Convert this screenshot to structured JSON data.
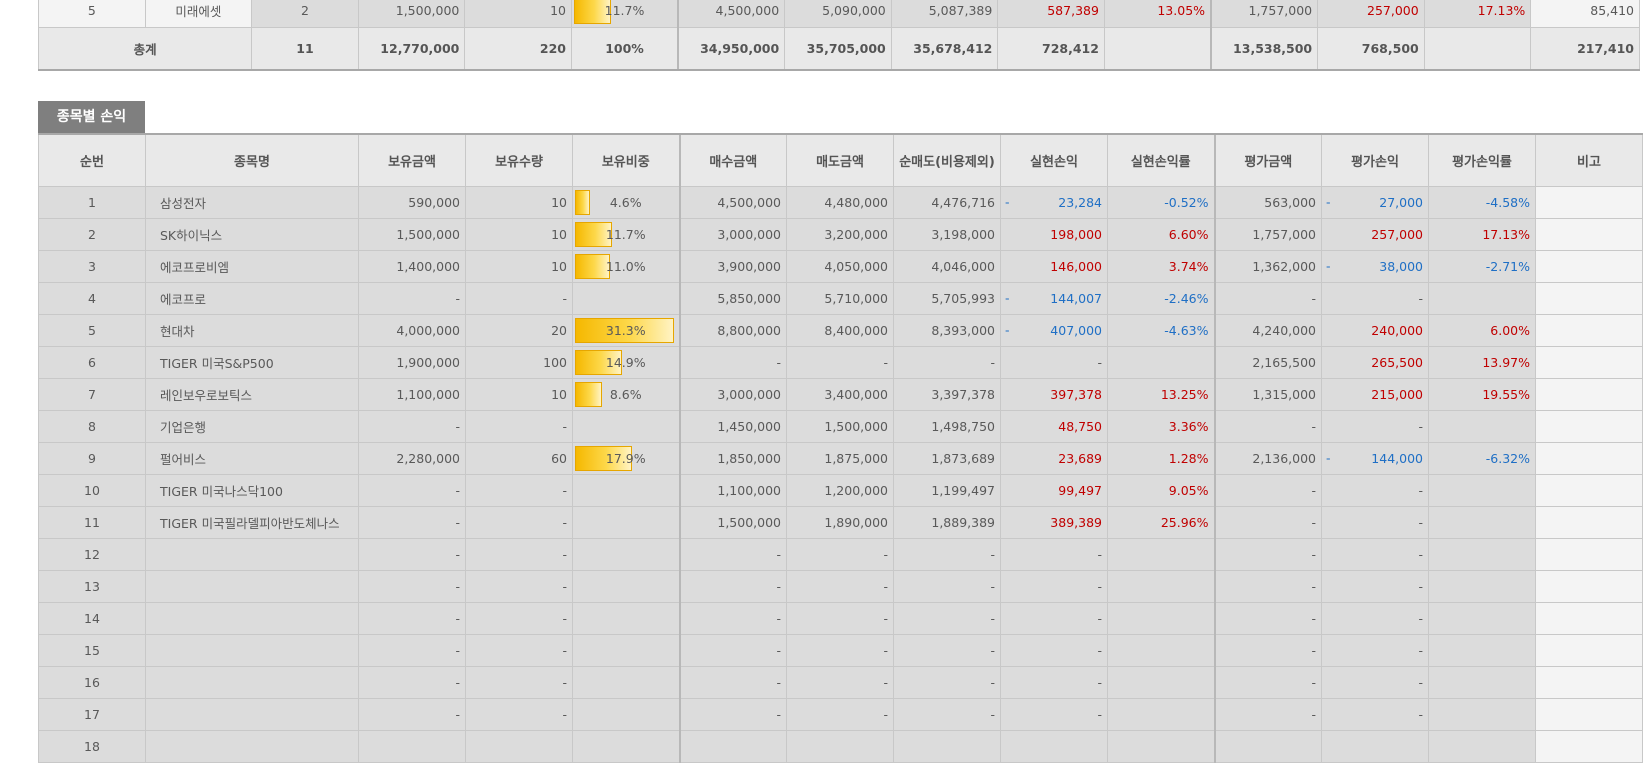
{
  "summary": {
    "top_row": {
      "no": "5",
      "name": "미래에셋",
      "count": "2",
      "holding": "1,500,000",
      "qty": "10",
      "weight": "11.7%",
      "weight_value": 11.7,
      "buy": "4,500,000",
      "sell": "5,090,000",
      "net_sell": "5,087,389",
      "realized": "587,389",
      "realized_rate": "13.05%",
      "eval": "1,757,000",
      "eval_pnl": "257,000",
      "eval_rate": "17.13%",
      "note": "85,410"
    },
    "total_row": {
      "label": "총계",
      "count": "11",
      "holding": "12,770,000",
      "qty": "220",
      "weight": "100%",
      "buy": "34,950,000",
      "sell": "35,705,000",
      "net_sell": "35,678,412",
      "realized": "728,412",
      "realized_rate": "",
      "eval": "13,538,500",
      "eval_pnl": "768,500",
      "eval_rate": "",
      "note": "217,410"
    }
  },
  "section_title": "종목별 손익",
  "headers": [
    "순번",
    "종목명",
    "보유금액",
    "보유수량",
    "보유비중",
    "매수금액",
    "매도금액",
    "순매도(비용제외)",
    "실현손익",
    "실현손익률",
    "평가금액",
    "평가손익",
    "평가손익률",
    "비고"
  ],
  "rows": [
    {
      "no": "1",
      "name": "삼성전자",
      "holding": "590,000",
      "qty": "10",
      "weight": "4.6%",
      "w": 4.6,
      "buy": "4,500,000",
      "sell": "4,480,000",
      "net": "4,476,716",
      "rp_neg": true,
      "rp": "23,284",
      "rr": "-0.52%",
      "rr_neg": true,
      "ev": "563,000",
      "ep_neg": true,
      "ep": "27,000",
      "er": "-4.58%",
      "er_neg": true
    },
    {
      "no": "2",
      "name": "SK하이닉스",
      "holding": "1,500,000",
      "qty": "10",
      "weight": "11.7%",
      "w": 11.7,
      "buy": "3,000,000",
      "sell": "3,200,000",
      "net": "3,198,000",
      "rp_neg": false,
      "rp": "198,000",
      "rr": "6.60%",
      "rr_neg": false,
      "ev": "1,757,000",
      "ep_neg": false,
      "ep": "257,000",
      "er": "17.13%",
      "er_neg": false
    },
    {
      "no": "3",
      "name": "에코프로비엠",
      "holding": "1,400,000",
      "qty": "10",
      "weight": "11.0%",
      "w": 11.0,
      "buy": "3,900,000",
      "sell": "4,050,000",
      "net": "4,046,000",
      "rp_neg": false,
      "rp": "146,000",
      "rr": "3.74%",
      "rr_neg": false,
      "ev": "1,362,000",
      "ep_neg": true,
      "ep": "38,000",
      "er": "-2.71%",
      "er_neg": true
    },
    {
      "no": "4",
      "name": "에코프로",
      "holding": "-",
      "qty": "-",
      "weight": "",
      "w": 0,
      "buy": "5,850,000",
      "sell": "5,710,000",
      "net": "5,705,993",
      "rp_neg": true,
      "rp": "144,007",
      "rr": "-2.46%",
      "rr_neg": true,
      "ev": "-",
      "ep_neg": false,
      "ep": "-",
      "er": "",
      "er_neg": false
    },
    {
      "no": "5",
      "name": "현대차",
      "holding": "4,000,000",
      "qty": "20",
      "weight": "31.3%",
      "w": 31.3,
      "buy": "8,800,000",
      "sell": "8,400,000",
      "net": "8,393,000",
      "rp_neg": true,
      "rp": "407,000",
      "rr": "-4.63%",
      "rr_neg": true,
      "ev": "4,240,000",
      "ep_neg": false,
      "ep": "240,000",
      "er": "6.00%",
      "er_neg": false
    },
    {
      "no": "6",
      "name": "TIGER 미국S&P500",
      "holding": "1,900,000",
      "qty": "100",
      "weight": "14.9%",
      "w": 14.9,
      "buy": "-",
      "sell": "-",
      "net": "-",
      "rp_neg": false,
      "rp": "-",
      "rr": "",
      "rr_neg": false,
      "ev": "2,165,500",
      "ep_neg": false,
      "ep": "265,500",
      "er": "13.97%",
      "er_neg": false
    },
    {
      "no": "7",
      "name": "레인보우로보틱스",
      "holding": "1,100,000",
      "qty": "10",
      "weight": "8.6%",
      "w": 8.6,
      "buy": "3,000,000",
      "sell": "3,400,000",
      "net": "3,397,378",
      "rp_neg": false,
      "rp": "397,378",
      "rr": "13.25%",
      "rr_neg": false,
      "ev": "1,315,000",
      "ep_neg": false,
      "ep": "215,000",
      "er": "19.55%",
      "er_neg": false
    },
    {
      "no": "8",
      "name": "기업은행",
      "holding": "-",
      "qty": "-",
      "weight": "",
      "w": 0,
      "buy": "1,450,000",
      "sell": "1,500,000",
      "net": "1,498,750",
      "rp_neg": false,
      "rp": "48,750",
      "rr": "3.36%",
      "rr_neg": false,
      "ev": "-",
      "ep_neg": false,
      "ep": "-",
      "er": "",
      "er_neg": false
    },
    {
      "no": "9",
      "name": "펄어비스",
      "holding": "2,280,000",
      "qty": "60",
      "weight": "17.9%",
      "w": 17.9,
      "buy": "1,850,000",
      "sell": "1,875,000",
      "net": "1,873,689",
      "rp_neg": false,
      "rp": "23,689",
      "rr": "1.28%",
      "rr_neg": false,
      "ev": "2,136,000",
      "ep_neg": true,
      "ep": "144,000",
      "er": "-6.32%",
      "er_neg": true
    },
    {
      "no": "10",
      "name": "TIGER 미국나스닥100",
      "holding": "-",
      "qty": "-",
      "weight": "",
      "w": 0,
      "buy": "1,100,000",
      "sell": "1,200,000",
      "net": "1,199,497",
      "rp_neg": false,
      "rp": "99,497",
      "rr": "9.05%",
      "rr_neg": false,
      "ev": "-",
      "ep_neg": false,
      "ep": "-",
      "er": "",
      "er_neg": false
    },
    {
      "no": "11",
      "name": "TIGER 미국필라델피아반도체나스",
      "holding": "-",
      "qty": "-",
      "weight": "",
      "w": 0,
      "buy": "1,500,000",
      "sell": "1,890,000",
      "net": "1,889,389",
      "rp_neg": false,
      "rp": "389,389",
      "rr": "25.96%",
      "rr_neg": false,
      "ev": "-",
      "ep_neg": false,
      "ep": "-",
      "er": "",
      "er_neg": false
    },
    {
      "no": "12",
      "name": "",
      "holding": "-",
      "qty": "-",
      "weight": "",
      "w": 0,
      "buy": "-",
      "sell": "-",
      "net": "-",
      "rp_neg": false,
      "rp": "-",
      "rr": "",
      "rr_neg": false,
      "ev": "-",
      "ep_neg": false,
      "ep": "-",
      "er": "",
      "er_neg": false
    },
    {
      "no": "13",
      "name": "",
      "holding": "-",
      "qty": "-",
      "weight": "",
      "w": 0,
      "buy": "-",
      "sell": "-",
      "net": "-",
      "rp_neg": false,
      "rp": "-",
      "rr": "",
      "rr_neg": false,
      "ev": "-",
      "ep_neg": false,
      "ep": "-",
      "er": "",
      "er_neg": false
    },
    {
      "no": "14",
      "name": "",
      "holding": "-",
      "qty": "-",
      "weight": "",
      "w": 0,
      "buy": "-",
      "sell": "-",
      "net": "-",
      "rp_neg": false,
      "rp": "-",
      "rr": "",
      "rr_neg": false,
      "ev": "-",
      "ep_neg": false,
      "ep": "-",
      "er": "",
      "er_neg": false
    },
    {
      "no": "15",
      "name": "",
      "holding": "-",
      "qty": "-",
      "weight": "",
      "w": 0,
      "buy": "-",
      "sell": "-",
      "net": "-",
      "rp_neg": false,
      "rp": "-",
      "rr": "",
      "rr_neg": false,
      "ev": "-",
      "ep_neg": false,
      "ep": "-",
      "er": "",
      "er_neg": false
    },
    {
      "no": "16",
      "name": "",
      "holding": "-",
      "qty": "-",
      "weight": "",
      "w": 0,
      "buy": "-",
      "sell": "-",
      "net": "-",
      "rp_neg": false,
      "rp": "-",
      "rr": "",
      "rr_neg": false,
      "ev": "-",
      "ep_neg": false,
      "ep": "-",
      "er": "",
      "er_neg": false
    },
    {
      "no": "17",
      "name": "",
      "holding": "-",
      "qty": "-",
      "weight": "",
      "w": 0,
      "buy": "-",
      "sell": "-",
      "net": "-",
      "rp_neg": false,
      "rp": "-",
      "rr": "",
      "rr_neg": false,
      "ev": "-",
      "ep_neg": false,
      "ep": "-",
      "er": "",
      "er_neg": false
    },
    {
      "no": "18",
      "name": "",
      "holding": "",
      "qty": "",
      "weight": "",
      "w": 0,
      "buy": "",
      "sell": "",
      "net": "",
      "rp_neg": false,
      "rp": "",
      "rr": "",
      "rr_neg": false,
      "ev": "",
      "ep_neg": false,
      "ep": "",
      "er": "",
      "er_neg": false
    }
  ],
  "negative_marker": "-",
  "colors": {
    "positive": "#c00000",
    "negative": "#1f6fc5",
    "bar": "#f5b800",
    "section": "#7f7f7f"
  }
}
